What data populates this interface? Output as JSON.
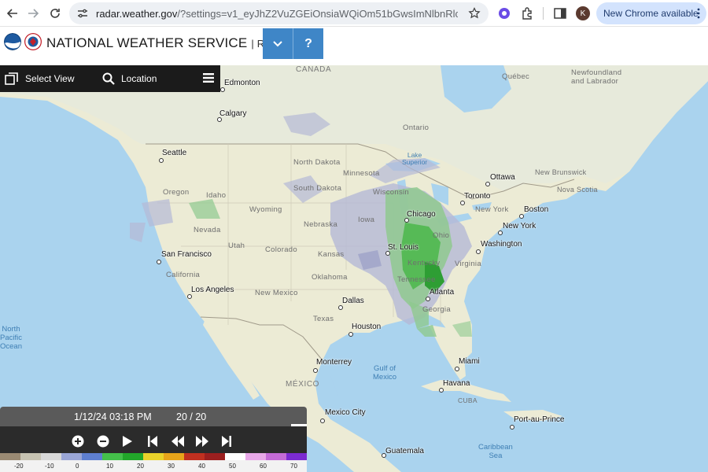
{
  "browser": {
    "url_main": "radar.weather.gov",
    "url_rest": "/?settings=v1_eyJhZ2VuZGEiOnsiaWQiOm51bGwsImNlbnRlciI6Wy05N...",
    "profile_initial": "K",
    "update_label": "New Chrome available"
  },
  "header": {
    "title": "NATIONAL WEATHER SERVICE",
    "subtitle": "| Radar",
    "help_label": "?"
  },
  "toolbar": {
    "select_view": "Select View",
    "location": "Location"
  },
  "map": {
    "cities": [
      {
        "name": "Edmonton"
      },
      {
        "name": "Calgary"
      },
      {
        "name": "Seattle"
      },
      {
        "name": "San Francisco"
      },
      {
        "name": "Los Angeles"
      },
      {
        "name": "Dallas"
      },
      {
        "name": "Houston"
      },
      {
        "name": "Chicago"
      },
      {
        "name": "St. Louis"
      },
      {
        "name": "Atlanta"
      },
      {
        "name": "Toronto"
      },
      {
        "name": "Ottawa"
      },
      {
        "name": "Boston"
      },
      {
        "name": "New York"
      },
      {
        "name": "Washington"
      },
      {
        "name": "Miami"
      },
      {
        "name": "Havana"
      },
      {
        "name": "Monterrey"
      },
      {
        "name": "Mexico City"
      },
      {
        "name": "Guatemala"
      },
      {
        "name": "Port-au-Prince"
      }
    ],
    "regions": {
      "canada": "CANADA",
      "quebec": "Québec",
      "ontario": "Ontario",
      "newfoundland": "Newfoundland and Labrador",
      "new_brunswick": "New Brunswick",
      "nova_scotia": "Nova Scotia",
      "north_dakota": "North Dakota",
      "south_dakota": "South Dakota",
      "minnesota": "Minnesota",
      "wisconsin": "Wisconsin",
      "iowa": "Iowa",
      "nebraska": "Nebraska",
      "kansas": "Kansas",
      "oklahoma": "Oklahoma",
      "texas": "Texas",
      "new_mexico": "New Mexico",
      "colorado": "Colorado",
      "utah": "Utah",
      "nevada": "Nevada",
      "california": "California",
      "idaho": "Idaho",
      "wyoming": "Wyoming",
      "oregon": "Oregon",
      "ohio": "Ohio",
      "kentucky": "Kentucky",
      "tennessee": "Tennessee",
      "virginia": "Virginia",
      "georgia": "Georgia",
      "new_york": "New York",
      "mexico": "MÉXICO",
      "cuba": "CUBA"
    },
    "water": {
      "north_pacific": "North\nPacific\nOcean",
      "gulf": "Gulf of\nMexico",
      "caribbean": "Caribbean\nSea",
      "lake_superior": "Lake\nSuperior"
    }
  },
  "playback": {
    "timestamp": "1/12/24 03:18 PM",
    "frame": "20 / 20",
    "frame_progress": 1.0
  },
  "legend": {
    "ticks": [
      "-20",
      "-10",
      "0",
      "10",
      "20",
      "30",
      "40",
      "50",
      "60",
      "70"
    ],
    "colors": [
      "#9a8a73",
      "#c7c3b2",
      "#d8d8d8",
      "#9aa6d6",
      "#5e7fd0",
      "#44c04a",
      "#22a72a",
      "#e9d22a",
      "#e7a41a",
      "#c03020",
      "#9b1f1f",
      "#ffffff",
      "#e8a8e8",
      "#c46bd6",
      "#7b2bd1"
    ]
  }
}
